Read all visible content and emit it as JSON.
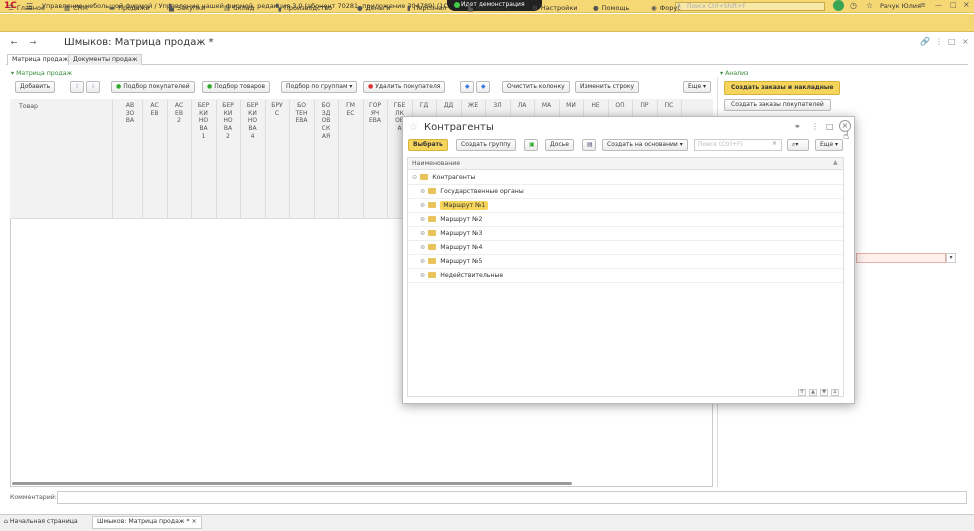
{
  "app": {
    "logo": "1С",
    "title": "Управление небольшой фирмой / Управление нашей фирмой, редакция 3.0 (абонент 70281, приложение 304789) (1С:Предпр",
    "demo": "Идет демонстрация",
    "search_placeholder": "Поиск Ctrl+Shift+F",
    "user": "Рачук Юлия"
  },
  "sections": [
    "Главное",
    "CRM",
    "Продажи",
    "Закупки",
    "Склад",
    "Производство",
    "Деньги",
    "Персонал",
    "Компания",
    "Настройки",
    "Помощь",
    "Форус"
  ],
  "doc": {
    "title": "Шмыков: Матрица продаж *"
  },
  "tabs": [
    "Матрица продаж",
    "Документы продаж"
  ],
  "group_left": "Матрица продаж",
  "group_right": "Анализ",
  "toolbar": {
    "add": "Добавить",
    "pick_buyers": "Подбор покупателей",
    "pick_goods": "Подбор товаров",
    "pick_groups": "Подбор по группам",
    "delete_buyer": "Удалить покупателя",
    "clear_col": "Очистить колонку",
    "change_row": "Изменить строку",
    "more": "Еще"
  },
  "right_buttons": {
    "create_orders": "Создать заказы и накладные",
    "create_buyer_orders": "Создать заказы покупателей"
  },
  "table": {
    "first_col": "Товар",
    "columns": [
      "АВЗОВА",
      "АСЕВ",
      "АСЕВ 2",
      "БЕРКИНОВА 1",
      "БЕРКИНОВА 2",
      "БЕРКИНОВА 4",
      "БРУС",
      "БОТЕНЕВА",
      "БОЗДОВСКАЯ",
      "ГМЕС",
      "ГОРЯЧЕВА",
      "ГБЕЛКОВА",
      "ГД",
      "ДД",
      "ЖЕ",
      "ЗЛ",
      "ЛА",
      "МА",
      "МИ",
      "НЕ",
      "ОП",
      "ПР",
      "ПС"
    ]
  },
  "comment_label": "Комментарий:",
  "bottom_tabs": [
    "Начальная страница",
    "Шмыков: Матрица продаж *"
  ],
  "modal": {
    "title": "Контрагенты",
    "buttons": {
      "select": "Выбрать",
      "create_group": "Создать группу",
      "dossier": "Досье",
      "create_based": "Создать на основании",
      "more": "Еще"
    },
    "search_placeholder": "Поиск (Ctrl+F)",
    "column": "Наименование",
    "rows": [
      {
        "label": "Контрагенты",
        "level": 0,
        "selected": false
      },
      {
        "label": "Государственные органы",
        "level": 1,
        "selected": false
      },
      {
        "label": "Маршрут №1",
        "level": 1,
        "selected": true
      },
      {
        "label": "Маршрут №2",
        "level": 1,
        "selected": false
      },
      {
        "label": "Маршрут №3",
        "level": 1,
        "selected": false
      },
      {
        "label": "Маршрут №4",
        "level": 1,
        "selected": false
      },
      {
        "label": "Маршрут №5",
        "level": 1,
        "selected": false
      },
      {
        "label": "Недействительные",
        "level": 1,
        "selected": false
      }
    ]
  }
}
